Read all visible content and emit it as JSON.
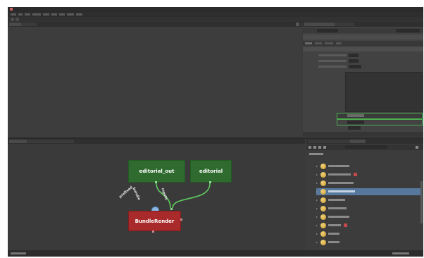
{
  "nodes": {
    "editorial_out": "editorial_out",
    "editorial": "editorial",
    "bundle_render": "BundleRender",
    "ports": {
      "prefixed": "prefixed",
      "bundle": "bundle",
      "inputs": "inputs"
    }
  },
  "colors": {
    "node_green": "#2f6b2f",
    "node_red": "#a82a2a",
    "selection_blue": "#56789c",
    "highlight_green": "#4caf50",
    "wire_green": "#5ec95e"
  }
}
